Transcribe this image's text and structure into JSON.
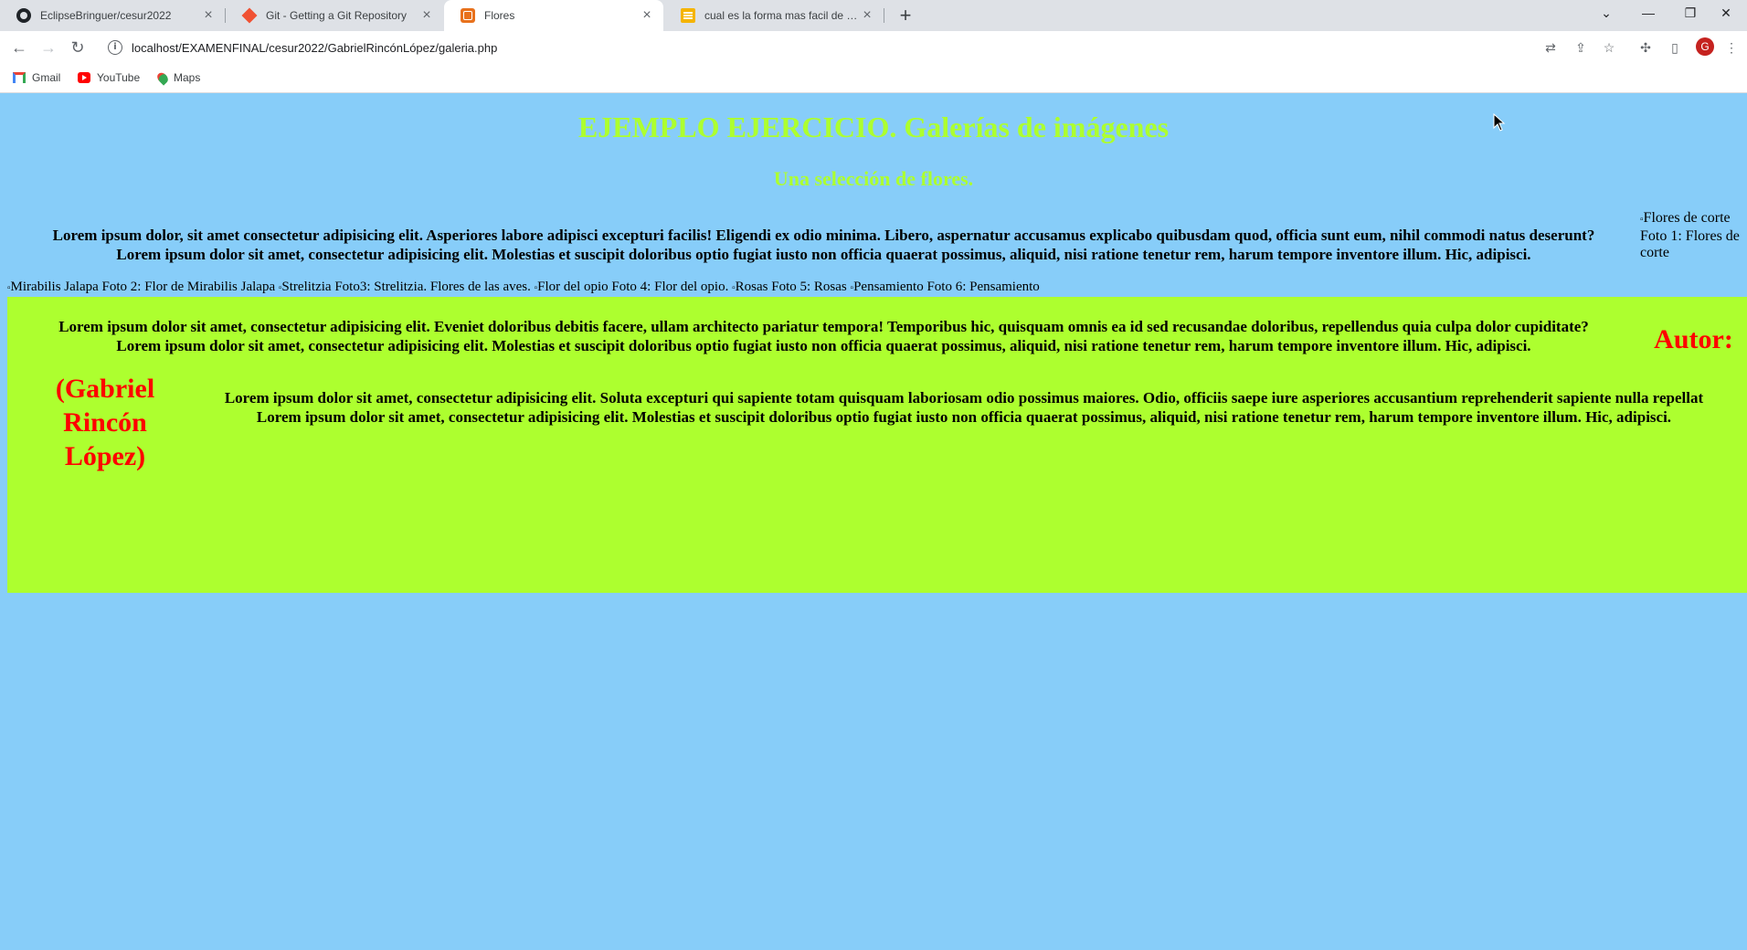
{
  "browser": {
    "tabs": [
      {
        "title": "EclipseBringuer/cesur2022",
        "icon": "github-icon"
      },
      {
        "title": "Git - Getting a Git Repository",
        "icon": "git-icon"
      },
      {
        "title": "Flores",
        "icon": "page-icon",
        "active": true
      },
      {
        "title": "cual es la forma mas facil de colo",
        "icon": "document-icon"
      }
    ],
    "url": "localhost/EXAMENFINAL/cesur2022/GabrielRincónLópez/galeria.php",
    "profile_initial": "G",
    "bookmarks": [
      "Gmail",
      "YouTube",
      "Maps"
    ]
  },
  "page": {
    "title": "EJEMPLO EJERCICIO. Galerías de imágenes",
    "subtitle": "Una selección de flores.",
    "intro_line1": "Lorem ipsum dolor, sit amet consectetur adipisicing elit. Asperiores labore adipisci excepturi facilis! Eligendi ex odio minima. Libero, aspernatur accusamus explicabo quibusdam quod, officia sunt eum, nihil commodi natus deserunt?",
    "intro_line2": "Lorem ipsum dolor sit amet, consectetur adipisicing elit. Molestias et suscipit doloribus optio fugiat iusto non officia quaerat possimus, aliquid, nisi ratione tenetur rem, harum tempore inventore illum. Hic, adipisci.",
    "side_figure": {
      "alt": "Flores de corte",
      "caption": "Foto 1: Flores de corte"
    },
    "gallery": [
      {
        "alt": "Mirabilis Jalapa",
        "caption": "Foto 2: Flor de Mirabilis Jalapa"
      },
      {
        "alt": "Strelitzia",
        "caption": "Foto3: Strelitzia. Flores de las aves."
      },
      {
        "alt": "Flor del opio",
        "caption": "Foto 4: Flor del opio."
      },
      {
        "alt": "Rosas",
        "caption": "Foto 5: Rosas"
      },
      {
        "alt": "Pensamiento",
        "caption": "Foto 6: Pensamiento"
      }
    ],
    "band_line1": "Lorem ipsum dolor sit amet, consectetur adipisicing elit. Eveniet doloribus debitis facere, ullam architecto pariatur tempora! Temporibus hic, quisquam omnis ea id sed recusandae doloribus, repellendus quia culpa dolor cupiditate?",
    "band_line2": "Lorem ipsum dolor sit amet, consectetur adipisicing elit. Molestias et suscipit doloribus optio fugiat iusto non officia quaerat possimus, aliquid, nisi ratione tenetur rem, harum tempore inventore illum. Hic, adipisci.",
    "autor_label": "Autor:",
    "author_name": "(Gabriel Rincón López)",
    "band2_line1": "Lorem ipsum dolor sit amet, consectetur adipisicing elit. Soluta excepturi qui sapiente totam quisquam laboriosam odio possimus maiores. Odio, officiis saepe iure asperiores accusantium reprehenderit sapiente nulla repellat",
    "band2_line2": "Lorem ipsum dolor sit amet, consectetur adipisicing elit. Molestias et suscipit doloribus optio fugiat iusto non officia quaerat possimus, aliquid, nisi ratione tenetur rem, harum tempore inventore illum. Hic, adipisci."
  },
  "colors": {
    "page_background": "#87cdf9",
    "heading": "#adff2f",
    "band": "#adff2f",
    "author": "#ff0000"
  }
}
